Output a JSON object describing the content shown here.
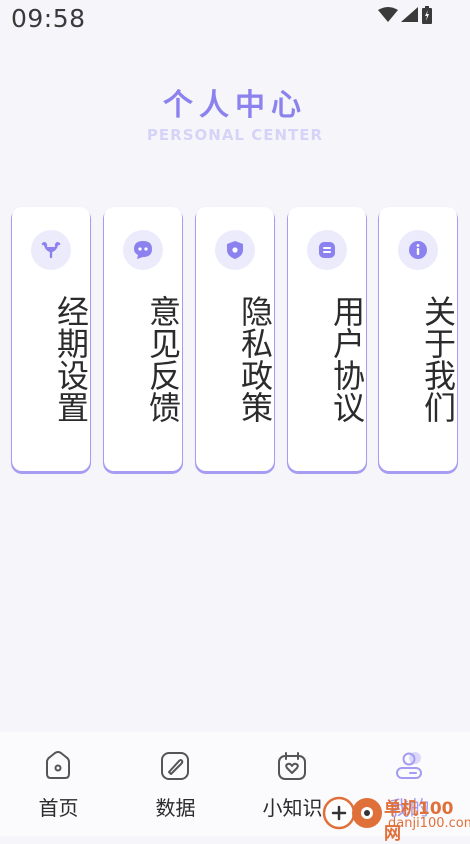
{
  "status_bar": {
    "time": "09:58"
  },
  "header": {
    "title": "个人中心",
    "subtitle": "PERSONAL CENTER"
  },
  "cards": [
    {
      "label": "经期设置",
      "icon": "uterus-icon"
    },
    {
      "label": "意见反馈",
      "icon": "chat-bubble-icon"
    },
    {
      "label": "隐私政策",
      "icon": "shield-icon"
    },
    {
      "label": "用户协议",
      "icon": "document-icon"
    },
    {
      "label": "关于我们",
      "icon": "info-icon"
    }
  ],
  "tabs": [
    {
      "label": "首页",
      "icon": "home-icon"
    },
    {
      "label": "数据",
      "icon": "edit-icon"
    },
    {
      "label": "小知识",
      "icon": "calendar-heart-icon"
    },
    {
      "label": "我的",
      "icon": "user-icon",
      "active": true
    }
  ],
  "watermark": {
    "text": "单机100网",
    "url": "danji100.com"
  },
  "colors": {
    "accent": "#8b82ef",
    "accent_light": "#ecebfb",
    "active_tab": "#a49cf2"
  }
}
